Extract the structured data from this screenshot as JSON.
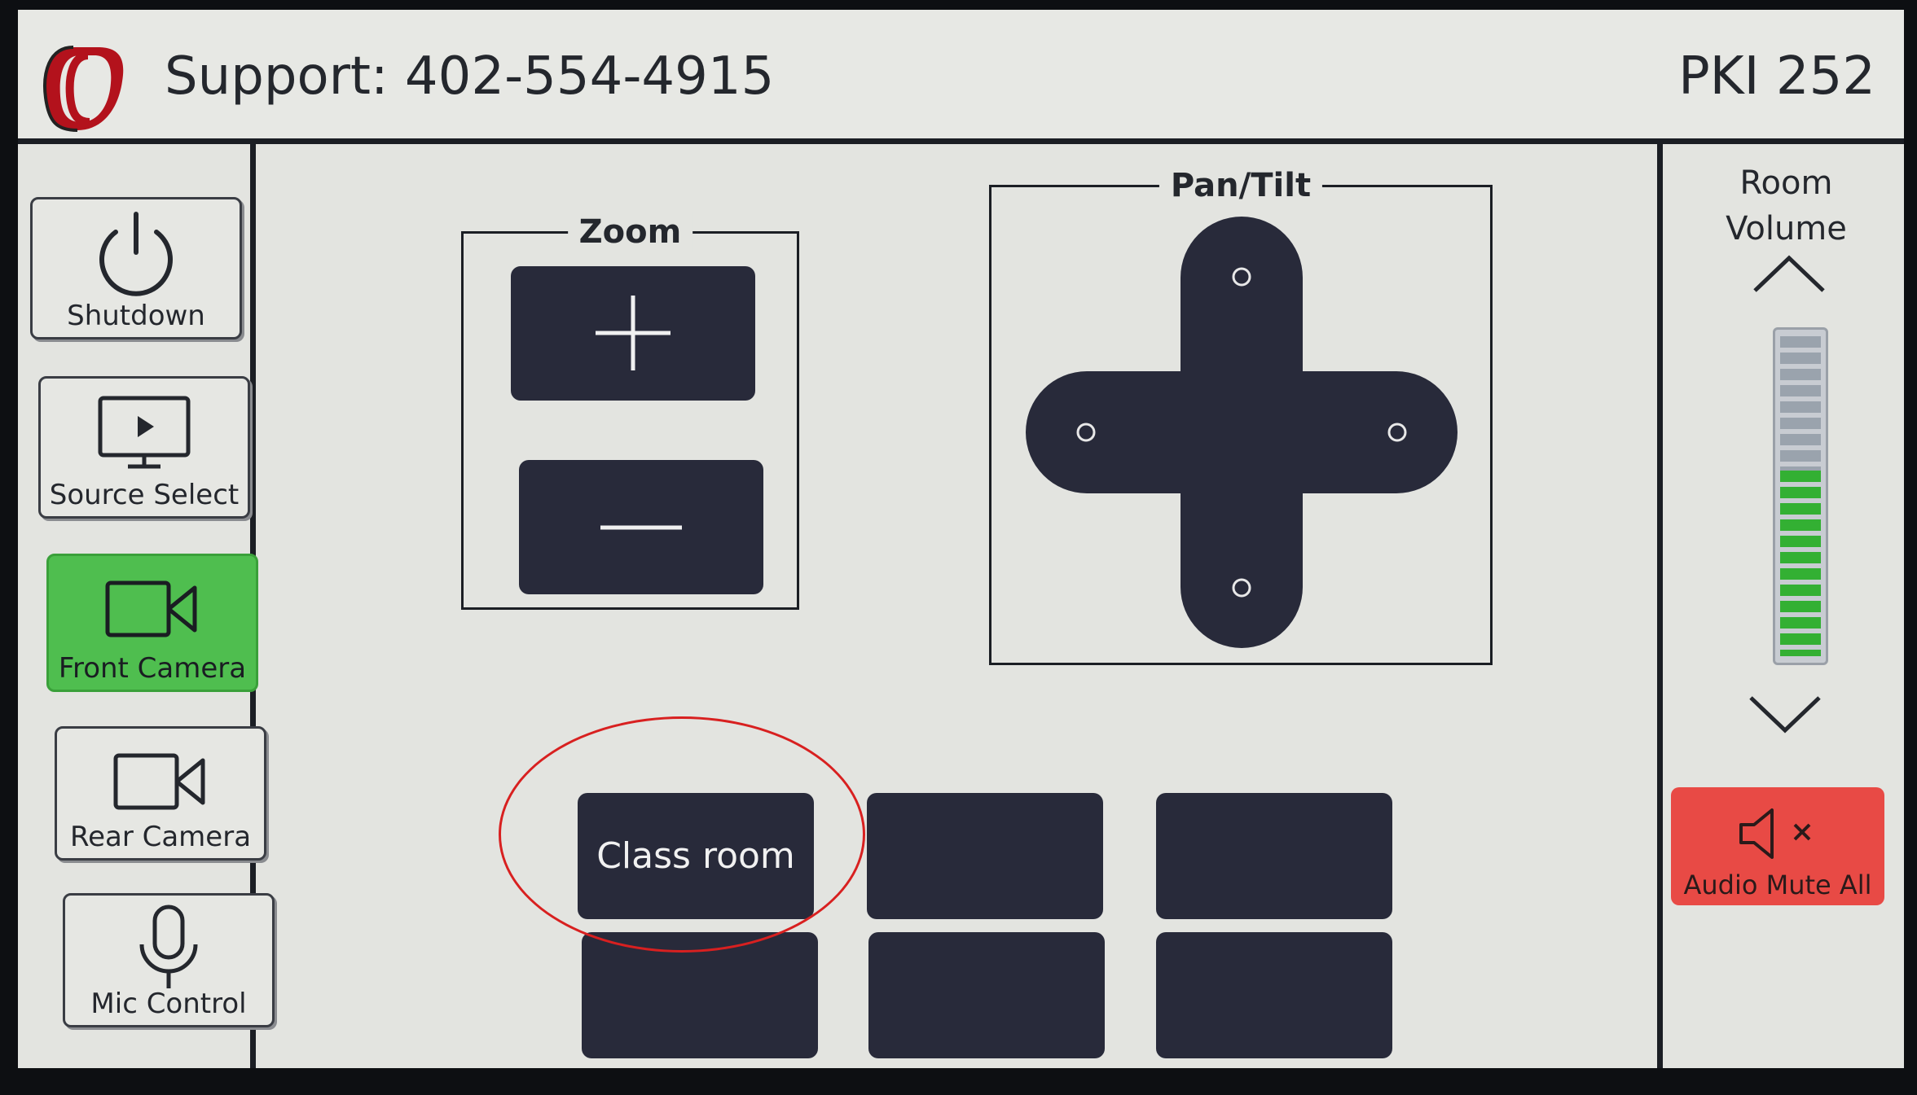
{
  "header": {
    "support_text": "Support: 402-554-4915",
    "room_name": "PKI 252"
  },
  "nav": {
    "items": [
      {
        "label": "Shutdown",
        "icon": "power-icon",
        "active": false
      },
      {
        "label": "Source Select",
        "icon": "monitor-play-icon",
        "active": false
      },
      {
        "label": "Front Camera",
        "icon": "video-camera-icon",
        "active": true
      },
      {
        "label": "Rear Camera",
        "icon": "video-camera-icon",
        "active": false
      },
      {
        "label": "Mic Control",
        "icon": "microphone-icon",
        "active": false
      }
    ]
  },
  "zoom": {
    "title": "Zoom",
    "in_icon": "plus-icon",
    "out_icon": "minus-icon"
  },
  "pantilt": {
    "title": "Pan/Tilt"
  },
  "presets": {
    "items": [
      "Class room",
      "",
      "",
      "",
      "",
      ""
    ]
  },
  "volume": {
    "title_line1": "Room",
    "title_line2": "Volume",
    "level": 0.58,
    "up_icon": "chevron-up-icon",
    "down_icon": "chevron-down-icon"
  },
  "mute": {
    "label": "Audio Mute All",
    "icon": "speaker-mute-icon"
  },
  "colors": {
    "active_green": "#4fbe4f",
    "mute_red": "#e84a45",
    "button_dark": "#282a3a",
    "annotation_red": "#d82020"
  }
}
